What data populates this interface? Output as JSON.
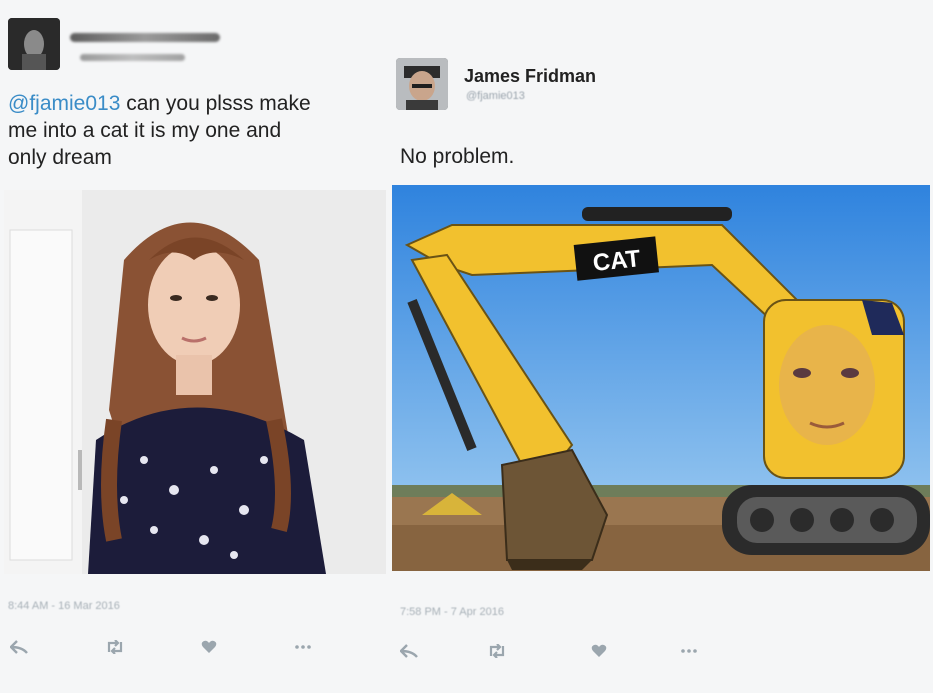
{
  "left_tweet": {
    "mention": "@fjamie013",
    "text_line1": " can you plsss make",
    "text_line2": "me into a cat it is my one and",
    "text_line3": "only dream",
    "timestamp": "8:44 AM - 16 Mar 2016"
  },
  "right_tweet": {
    "name": "James Fridman",
    "handle": "@fjamie013",
    "text": "No problem.",
    "excavator_brand": "CAT",
    "timestamp": "7:58 PM - 7 Apr 2016"
  },
  "actions": {
    "reply_icon": "reply-icon",
    "retweet_icon": "retweet-icon",
    "like_icon": "heart-icon",
    "more_icon": "more-icon"
  },
  "colors": {
    "mention": "#3a8cc7",
    "sky": "#3d8de0",
    "excavator_yellow": "#f2c12e"
  }
}
